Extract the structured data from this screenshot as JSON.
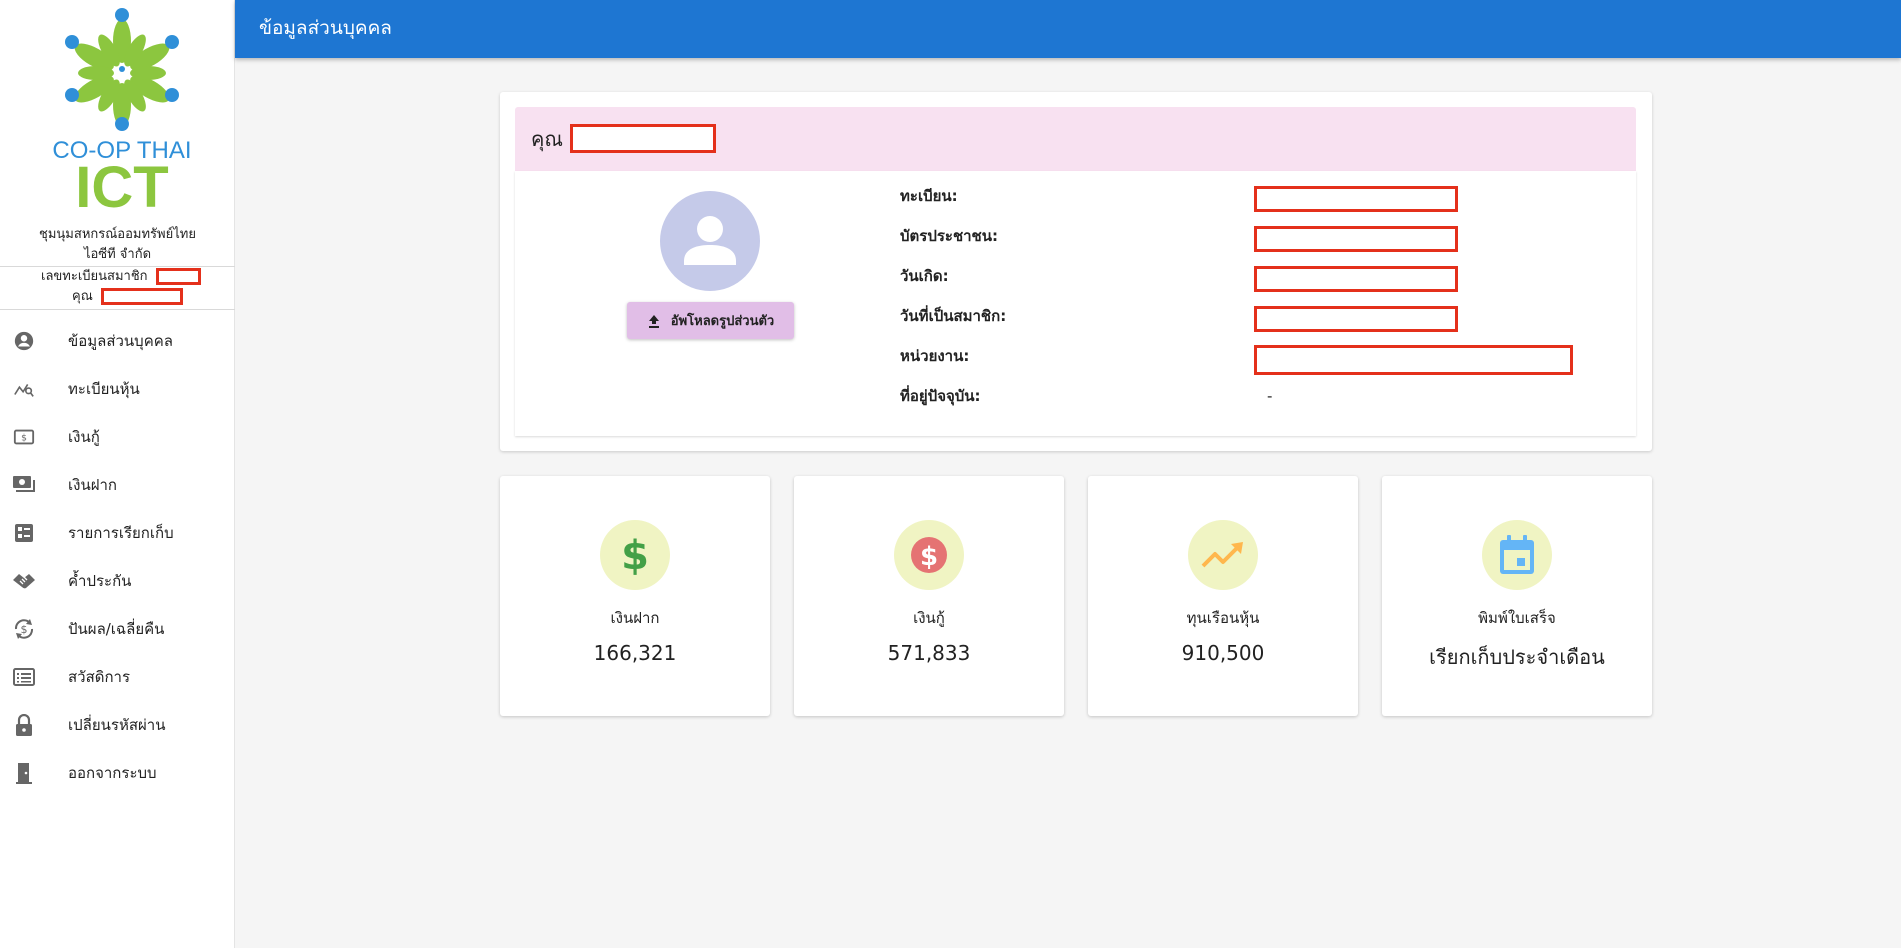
{
  "header": {
    "title": "ข้อมูลส่วนบุคคล"
  },
  "sidebar": {
    "logo": {
      "line1": "CO-OP THAI",
      "line2": "ICT"
    },
    "org_name_line1": "ชุมนุมสหกรณ์ออมทรัพย์ไทย",
    "org_name_line2": "ไอซีที จำกัด",
    "member_no_label": "เลขทะเบียนสมาชิก",
    "member_name_label": "คุณ",
    "items": [
      {
        "label": "ข้อมูลส่วนบุคคล",
        "icon": "account-circle-icon"
      },
      {
        "label": "ทะเบียนหุ้น",
        "icon": "chart-search-icon"
      },
      {
        "label": "เงินกู้",
        "icon": "cash-icon"
      },
      {
        "label": "เงินฝาก",
        "icon": "cash-multiple-icon"
      },
      {
        "label": "รายการเรียกเก็บ",
        "icon": "list-checklist-icon"
      },
      {
        "label": "ค้ำประกัน",
        "icon": "handshake-icon"
      },
      {
        "label": "ปันผล/เฉลี่ยคืน",
        "icon": "refresh-dollar-icon"
      },
      {
        "label": "สวัสดิการ",
        "icon": "list-box-icon"
      },
      {
        "label": "เปลี่ยนรหัสผ่าน",
        "icon": "lock-icon"
      },
      {
        "label": "ออกจากระบบ",
        "icon": "exit-door-icon"
      }
    ]
  },
  "profile": {
    "greeting": "คุณ",
    "upload_label": "อัพโหลดรูปส่วนตัว",
    "fields": [
      {
        "label": "ทะเบียน:",
        "value": ""
      },
      {
        "label": "บัตรประชาชน:",
        "value": ""
      },
      {
        "label": "วันเกิด:",
        "value": ""
      },
      {
        "label": "วันที่เป็นสมาชิก:",
        "value": ""
      },
      {
        "label": "หน่วยงาน:",
        "value": ""
      },
      {
        "label": "ที่อยู่ปัจจุบัน:",
        "value": "-"
      }
    ]
  },
  "stats": [
    {
      "label": "เงินฝาก",
      "value": "166,321",
      "icon": "dollar-icon",
      "color": "#43a047"
    },
    {
      "label": "เงินกู้",
      "value": "571,833",
      "icon": "dollar-circle-icon",
      "color": "#e57373"
    },
    {
      "label": "ทุนเรือนหุ้น",
      "value": "910,500",
      "icon": "trending-up-icon",
      "color": "#ffb74d"
    },
    {
      "label": "พิมพ์ใบเสร็จ",
      "value": "เรียกเก็บประจำเดือน",
      "icon": "calendar-icon",
      "color": "#64b5f6"
    }
  ],
  "colors": {
    "appbar": "#1e76d2",
    "redaction": "#e4301b",
    "profile_head": "#f8e1f1",
    "stat_circle": "#f0f4c3"
  }
}
